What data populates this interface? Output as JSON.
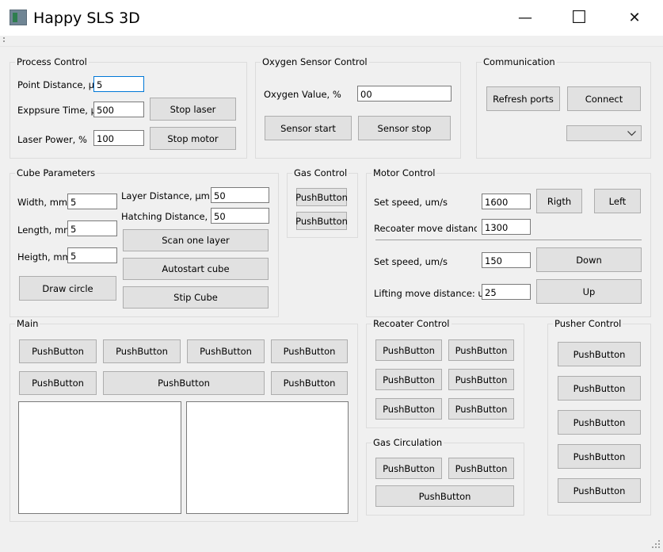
{
  "window": {
    "title": "Happy SLS 3D",
    "minimize": "—",
    "maximize": "☐",
    "close": "✕"
  },
  "process_control": {
    "title": "Process Control",
    "point_distance_label": "Point Distance, µm",
    "point_distance_value": "5",
    "exposure_time_label": "Exppsure Time, µs",
    "exposure_time_value": "500",
    "laser_power_label": "Laser Power, %",
    "laser_power_value": "100",
    "stop_laser": "Stop laser",
    "stop_motor": "Stop motor"
  },
  "oxygen": {
    "title": "Oxygen Sensor Control",
    "value_label": "Oxygen Value, %",
    "value": "00",
    "sensor_start": "Sensor start",
    "sensor_stop": "Sensor stop"
  },
  "communication": {
    "title": "Communication",
    "refresh_ports": "Refresh ports",
    "connect": "Connect",
    "port_select": ""
  },
  "cube": {
    "title": "Cube Parameters",
    "width_label": "Width, mm",
    "width_value": "5",
    "length_label": "Length, mm",
    "length_value": "5",
    "height_label": "Heigth, mm",
    "height_value": "5",
    "layer_distance_label": "Layer Distance, µm",
    "layer_distance_value": "50",
    "hatching_distance_label": "Hatching Distance, µm",
    "hatching_distance_value": "50",
    "scan_one_layer": "Scan one layer",
    "autostart_cube": "Autostart cube",
    "stip_cube": "Stip Cube",
    "draw_circle": "Draw circle"
  },
  "gas_control": {
    "title": "Gas Control",
    "btn1": "PushButton",
    "btn2": "PushButton"
  },
  "motor": {
    "title": "Motor Control",
    "set_speed1_label": "Set speed, um/s",
    "set_speed1_value": "1600",
    "recoater_distance_label": "Recoater move distance: u",
    "recoater_distance_value": "1300",
    "set_speed2_label": "Set speed, um/s",
    "set_speed2_value": "150",
    "lifting_distance_label": "Lifting move distance: um",
    "lifting_distance_value": "25",
    "right": "Rigth",
    "left": "Left",
    "down": "Down",
    "up": "Up"
  },
  "main": {
    "title": "Main",
    "row1": [
      "PushButton",
      "PushButton",
      "PushButton",
      "PushButton"
    ],
    "row2": [
      "PushButton",
      "PushButton",
      "PushButton"
    ]
  },
  "recoater": {
    "title": "Recoater Control",
    "buttons": [
      "PushButton",
      "PushButton",
      "PushButton",
      "PushButton",
      "PushButton",
      "PushButton"
    ]
  },
  "gas_circulation": {
    "title": "Gas Circulation",
    "buttons": [
      "PushButton",
      "PushButton",
      "PushButton"
    ]
  },
  "pusher": {
    "title": "Pusher Control",
    "buttons": [
      "PushButton",
      "PushButton",
      "PushButton",
      "PushButton",
      "PushButton"
    ]
  }
}
